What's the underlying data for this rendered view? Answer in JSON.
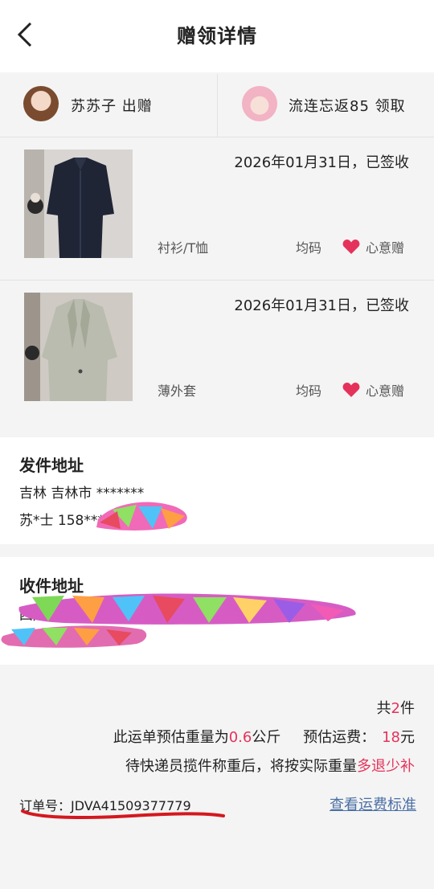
{
  "header": {
    "title": "赠领详情"
  },
  "users": {
    "giver": {
      "name": "苏苏子",
      "action": "出赠"
    },
    "receiver": {
      "name": "流连忘返85",
      "action": "领取"
    }
  },
  "items": [
    {
      "date": "2026年01月31日，已签收",
      "category": "衬衫/T恤",
      "size": "均码",
      "gift_label": "心意赠"
    },
    {
      "date": "2026年01月31日，已签收",
      "category": "薄外套",
      "size": "均码",
      "gift_label": "心意赠"
    }
  ],
  "sender": {
    "title": "发件地址",
    "line1": "吉林 吉林市 *******",
    "line2": "苏*士 158****"
  },
  "receiver": {
    "title": "收件地址",
    "line1": "四川 成都",
    "line2": ""
  },
  "footer": {
    "count_prefix": "共",
    "count": "2",
    "count_suffix": "件",
    "weight_prefix": "此运单预估重量为",
    "weight": "0.6",
    "weight_unit": "公斤",
    "fee_label": "预估运费：",
    "fee": "18",
    "fee_unit": "元",
    "note_prefix": "待快递员揽件称重后，将按实际重量",
    "note_highlight": "多退少补",
    "order_label": "订单号：",
    "order_no": "JDVA41509377779",
    "fee_standard_link": "查看运费标准"
  },
  "colors": {
    "accent_red": "#e5325b",
    "link_blue": "#4a6fa5"
  }
}
